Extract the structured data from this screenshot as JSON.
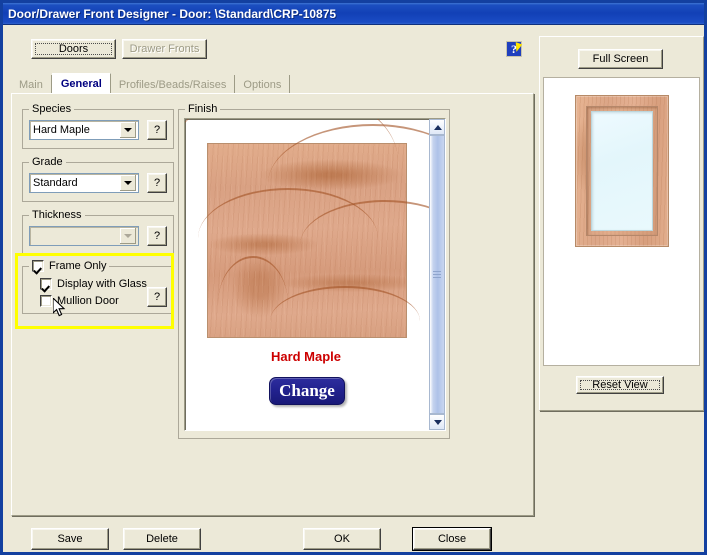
{
  "window": {
    "title": "Door/Drawer Front Designer - Door: \\Standard\\CRP-10875",
    "titlebar_color": "#1240b6",
    "face_color": "#ece9d8",
    "border_color": "#1340a0"
  },
  "toggles": {
    "doors_label": "Doors",
    "drawer_fronts_label": "Drawer Fronts"
  },
  "help": {
    "icon": "help-question-icon",
    "glyph": "?"
  },
  "tabs": [
    {
      "label": "Main",
      "active": false
    },
    {
      "label": "General",
      "active": true
    },
    {
      "label": "Profiles/Beads/Raises",
      "active": false
    },
    {
      "label": "Options",
      "active": false
    }
  ],
  "species": {
    "legend": "Species",
    "value": "Hard Maple",
    "help_label": "?"
  },
  "grade": {
    "legend": "Grade",
    "value": "Standard",
    "help_label": "?"
  },
  "thickness": {
    "legend": "Thickness",
    "value": "",
    "help_label": "?",
    "disabled": true
  },
  "frame_options": {
    "frame_only_label": "Frame Only",
    "frame_only_checked": true,
    "display_with_glass_label": "Display with Glass",
    "display_with_glass_checked": true,
    "mullion_door_label": "Mullion Door",
    "mullion_door_checked": false,
    "help_label": "?",
    "highlight_color": "#ffff00"
  },
  "finish": {
    "legend": "Finish",
    "swatch_name": "hard-maple-wood-texture",
    "swatch_color": "#d9a183",
    "label": "Hard Maple",
    "label_color": "#cc0000",
    "change_label": "Change",
    "change_color": "#22228f"
  },
  "preview": {
    "full_screen_label": "Full Screen",
    "reset_view_label": "Reset View",
    "door_name": "door-front-preview",
    "wood_color": "#dca687",
    "glass_color": "#e9f9fd"
  },
  "footer": {
    "save_label": "Save",
    "delete_label": "Delete",
    "ok_label": "OK",
    "close_label": "Close"
  }
}
